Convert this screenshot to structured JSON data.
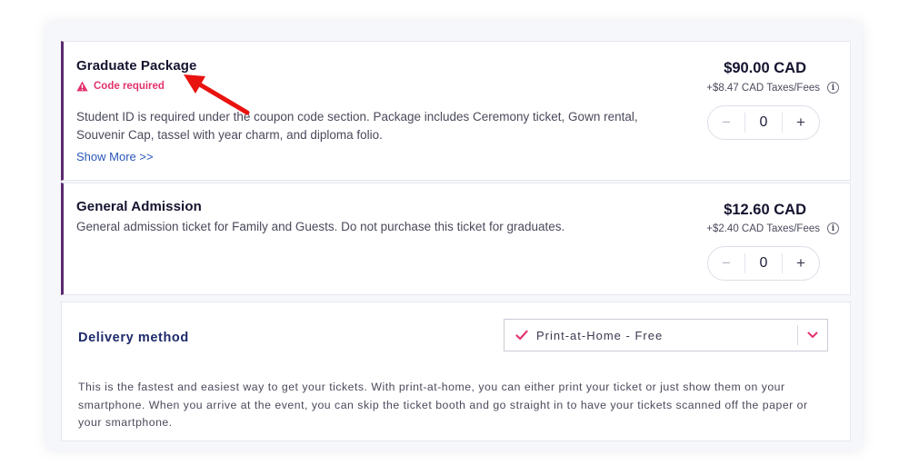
{
  "tickets": [
    {
      "name": "Graduate Package",
      "warning": "Code required",
      "description": "Student ID is required under the coupon code section. Package includes Ceremony ticket, Gown rental, Souvenir Cap, tassel with year charm, and diploma folio.",
      "show_more": "Show More >>",
      "price": "$90.00 CAD",
      "fees": "+$8.47 CAD Taxes/Fees",
      "quantity": "0",
      "minus": "−",
      "plus": "+"
    },
    {
      "name": "General Admission",
      "description": "General admission ticket for Family and Guests. Do not purchase this ticket for graduates.",
      "price": "$12.60 CAD",
      "fees": "+$2.40 CAD Taxes/Fees",
      "quantity": "0",
      "minus": "−",
      "plus": "+"
    }
  ],
  "delivery": {
    "label": "Delivery method",
    "selected": "Print-at-Home - Free",
    "info": "This is the fastest and easiest way to get your tickets. With print-at-home, you can either print your ticket or just show them on your smartphone. When you arrive at the event, you can skip the ticket booth and go straight in to have your tickets scanned off the paper or your smartphone."
  },
  "icons": {
    "warning": "warning-triangle-icon",
    "info": "info-icon",
    "check": "checkmark-icon",
    "chevron": "chevron-down-icon",
    "annotation": "red-arrow-annotation"
  },
  "colors": {
    "accent_bar": "#5a2a6e",
    "warning": "#e2336b",
    "link": "#2a57b8",
    "delivery_label": "#1f2a6b",
    "arrow": "#e8120f"
  }
}
